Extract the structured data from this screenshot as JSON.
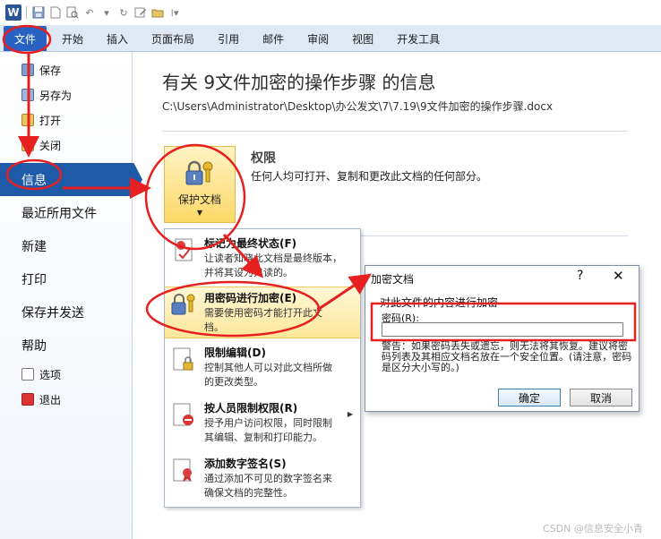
{
  "qat": {
    "word_logo": "W"
  },
  "tabs": [
    {
      "label": "文件"
    },
    {
      "label": "开始"
    },
    {
      "label": "插入"
    },
    {
      "label": "页面布局"
    },
    {
      "label": "引用"
    },
    {
      "label": "邮件"
    },
    {
      "label": "审阅"
    },
    {
      "label": "视图"
    },
    {
      "label": "开发工具"
    }
  ],
  "nav": {
    "save": "保存",
    "save_as": "另存为",
    "open": "打开",
    "close": "关闭",
    "info": "信息",
    "recent": "最近所用文件",
    "new": "新建",
    "print": "打印",
    "save_send": "保存并发送",
    "help": "帮助",
    "options": "选项",
    "exit": "退出"
  },
  "info": {
    "title": "有关 9文件加密的操作步骤 的信息",
    "path": "C:\\Users\\Administrator\\Desktop\\办公发文\\7\\7.19\\9文件加密的操作步骤.docx",
    "protect_label": "保护文档",
    "permissions_title": "权限",
    "permissions_desc": "任何人均可打开、复制和更改此文档的任何部分。"
  },
  "menu": {
    "final": {
      "title": "标记为最终状态(F)",
      "desc1": "让读者知晓此文档是最终版本，",
      "desc2": "并将其设为只读的。"
    },
    "encrypt": {
      "title": "用密码进行加密(E)",
      "desc1": "需要使用密码才能打开此文",
      "desc2": "档。"
    },
    "restrict": {
      "title": "限制编辑(D)",
      "desc1": "控制其他人可以对此文档所做",
      "desc2": "的更改类型。"
    },
    "people": {
      "title": "按人员限制权限(R)",
      "desc1": "授予用户访问权限，同时限制",
      "desc2": "其编辑、复制和打印能力。"
    },
    "signature": {
      "title": "添加数字签名(S)",
      "desc1": "通过添加不可见的数字签名来",
      "desc2": "确保文档的完整性。"
    }
  },
  "dialog": {
    "title": "加密文档",
    "help": "?",
    "close": "✕",
    "header": "对此文件的内容进行加密",
    "password_label": "密码(R):",
    "password_value": "",
    "warning": "警告：如果密码丢失或遗忘，则无法将其恢复。建议将密码列表及其相应文档名放在一个安全位置。(请注意，密码是区分大小写的。)",
    "ok": "确定",
    "cancel": "取消"
  },
  "watermark": "CSDN @信息安全小青",
  "colors": {
    "accent": "#1f5aa9",
    "annotation": "#e62020",
    "highlight": "#fde79a"
  }
}
